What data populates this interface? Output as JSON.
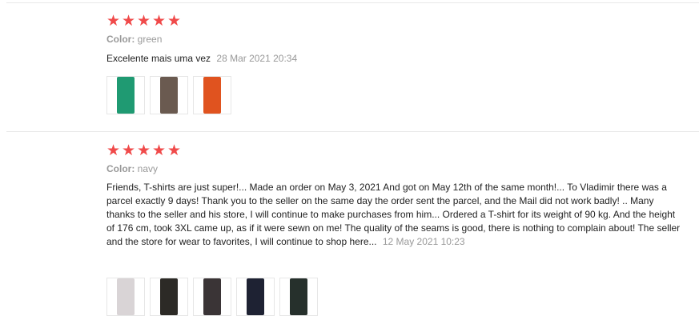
{
  "reviews": [
    {
      "rating": 5,
      "color_label": "Color:",
      "color_value": "green",
      "text": "Excelente mais uma vez",
      "date": "28 Mar 2021 20:34",
      "photos": [
        {
          "name": "photo-green-shirt",
          "color": "#1f9a72"
        },
        {
          "name": "photo-green-orange-shirt",
          "color": "#6a5a50"
        },
        {
          "name": "photo-orange-shirt",
          "color": "#e0531f"
        }
      ]
    },
    {
      "rating": 5,
      "color_label": "Color:",
      "color_value": "navy",
      "text": "Friends, T-shirts are just super!... Made an order on May 3, 2021 And got on May 12th of the same month!... To Vladimir there was a parcel exactly 9 days! Thank you to the seller on the same day the order sent the parcel, and the Mail did not work badly! .. Many thanks to the seller and his store, I will continue to make purchases from him... Ordered a T-shirt for its weight of 90 kg. And the height of 176 cm, took 3XL came up, as if it were sewn on me! The quality of the seams is good, there is nothing to complain about! The seller and the store for wear to favorites, I will continue to shop here...",
      "date": "12 May 2021 10:23",
      "photos": [
        {
          "name": "photo-package",
          "color": "#d9d4d6"
        },
        {
          "name": "photo-dark-shirt-1",
          "color": "#2c2a26"
        },
        {
          "name": "photo-dark-shirt-2",
          "color": "#3a3436"
        },
        {
          "name": "photo-navy-shirt",
          "color": "#1e2233"
        },
        {
          "name": "photo-black-shirt",
          "color": "#26302c"
        }
      ]
    }
  ],
  "star_glyph": "★",
  "star_color": "#f04a4a"
}
